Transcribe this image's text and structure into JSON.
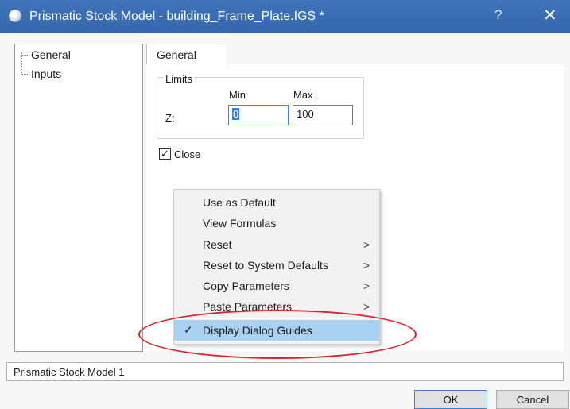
{
  "window": {
    "title": "Prismatic Stock Model - building_Frame_Plate.IGS *",
    "help_glyph": "?",
    "close_glyph": "✕"
  },
  "tree": {
    "items": [
      {
        "label": "General"
      },
      {
        "label": "Inputs"
      }
    ]
  },
  "tabs": [
    {
      "label": "General",
      "active": true
    }
  ],
  "limits": {
    "group_label": "Limits",
    "min_header": "Min",
    "max_header": "Max",
    "z_label": "Z:",
    "z_min": "0",
    "z_max": "100"
  },
  "close_option": {
    "label": "Close",
    "checked": true,
    "check_glyph": "✓"
  },
  "context_menu": {
    "items": [
      {
        "label": "Use as Default",
        "submenu": false
      },
      {
        "label": "View Formulas",
        "submenu": false
      },
      {
        "label": "Reset",
        "submenu": true
      },
      {
        "label": "Reset to System Defaults",
        "submenu": true
      },
      {
        "label": "Copy Parameters",
        "submenu": true
      },
      {
        "label": "Paste Parameters",
        "submenu": true
      },
      {
        "label": "Display Dialog Guides",
        "submenu": false,
        "checked": true,
        "highlighted": true
      }
    ],
    "arrow_glyph": ">",
    "check_glyph": "✓"
  },
  "annotation": {
    "ellipse_color": "#d9262b"
  },
  "status_field": {
    "value": "Prismatic Stock Model 1"
  },
  "buttons": {
    "ok_label": "OK",
    "cancel_label": "Cancel"
  },
  "colors": {
    "titlebar": "#3c6fb5",
    "menu_highlight": "#a8d1f2",
    "selection": "#3b82d6"
  }
}
